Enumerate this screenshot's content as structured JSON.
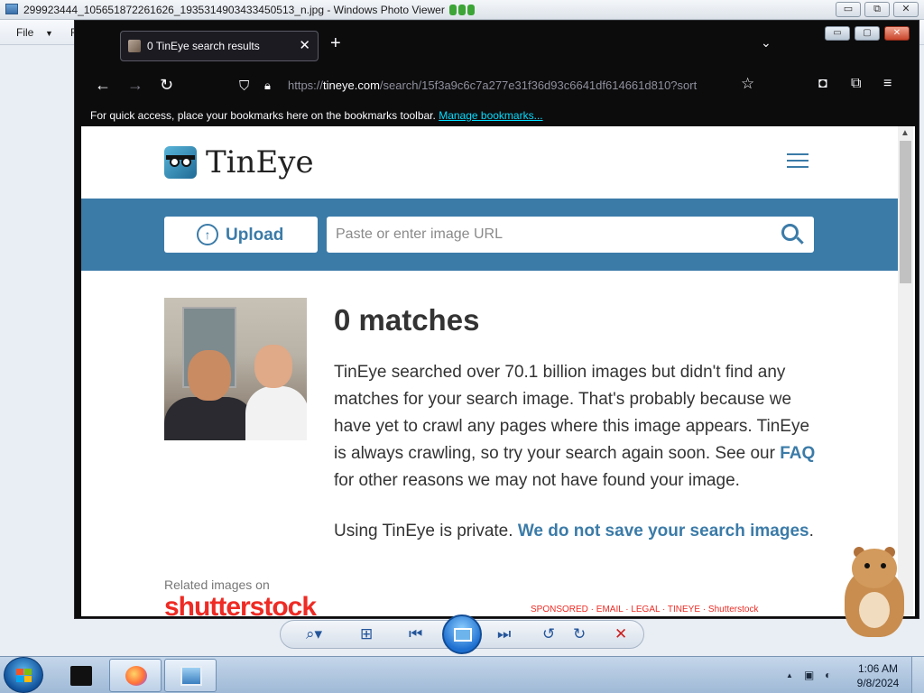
{
  "photo_viewer": {
    "window_title": "299923444_105651872261626_1935314903433450513_n.jpg - Windows Photo Viewer",
    "menu": [
      "File",
      "Fix"
    ],
    "controls": {
      "minimize": "▭",
      "maximize": "⧉",
      "close": "✕"
    }
  },
  "browser": {
    "tab_title": "0 TinEye search results",
    "tab_close": "✕",
    "new_tab": "+",
    "tab_list": "⌄",
    "back": "←",
    "forward": "→",
    "reload": "↻",
    "url_scheme": "https://",
    "url_domain": "tineye.com",
    "url_path": "/search/15f3a9c6c7a277e31f36d93c6641df614661d810?sort",
    "bookmark_star": "☆",
    "bookmarks_message": "For quick access, place your bookmarks here on the bookmarks toolbar.",
    "manage_bookmarks": "Manage bookmarks...",
    "window_controls": {
      "minimize": "▭",
      "maximize": "▢",
      "close": "✕"
    }
  },
  "tineye": {
    "brand": "TinEye",
    "upload_label": "Upload",
    "url_placeholder": "Paste or enter image URL",
    "heading": "0 matches",
    "message_before_link": "TinEye searched over 70.1 billion images but didn't find any matches for your search image. That's probably because we have yet to crawl any pages where this image appears. TinEye is always crawling, so try your search again soon. See our ",
    "faq_link": "FAQ",
    "message_after_link": " for other reasons we may not have found your image.",
    "privacy_text": "Using TinEye is private. ",
    "privacy_link": "We do not save your search images",
    "privacy_end": ".",
    "related_label": "Related images on",
    "shutterstock": "shutterstock",
    "footer_links": "SPONSORED · EMAIL · LEGAL · TINEYE · Shutterstock"
  },
  "viewer_toolbar": {
    "zoom": "⌕▾",
    "fit": "⊞",
    "previous": "⏮",
    "next": "⏭",
    "rotate_ccw": "↺",
    "rotate_cw": "↻",
    "delete": "✕"
  },
  "taskbar": {
    "time": "1:06 AM",
    "date": "9/8/2024",
    "tray_up": "▲"
  },
  "colors": {
    "tineye_blue": "#3b7ba8",
    "firefox_dark": "#0c0c0d",
    "shutterstock_red": "#ee2b24"
  }
}
